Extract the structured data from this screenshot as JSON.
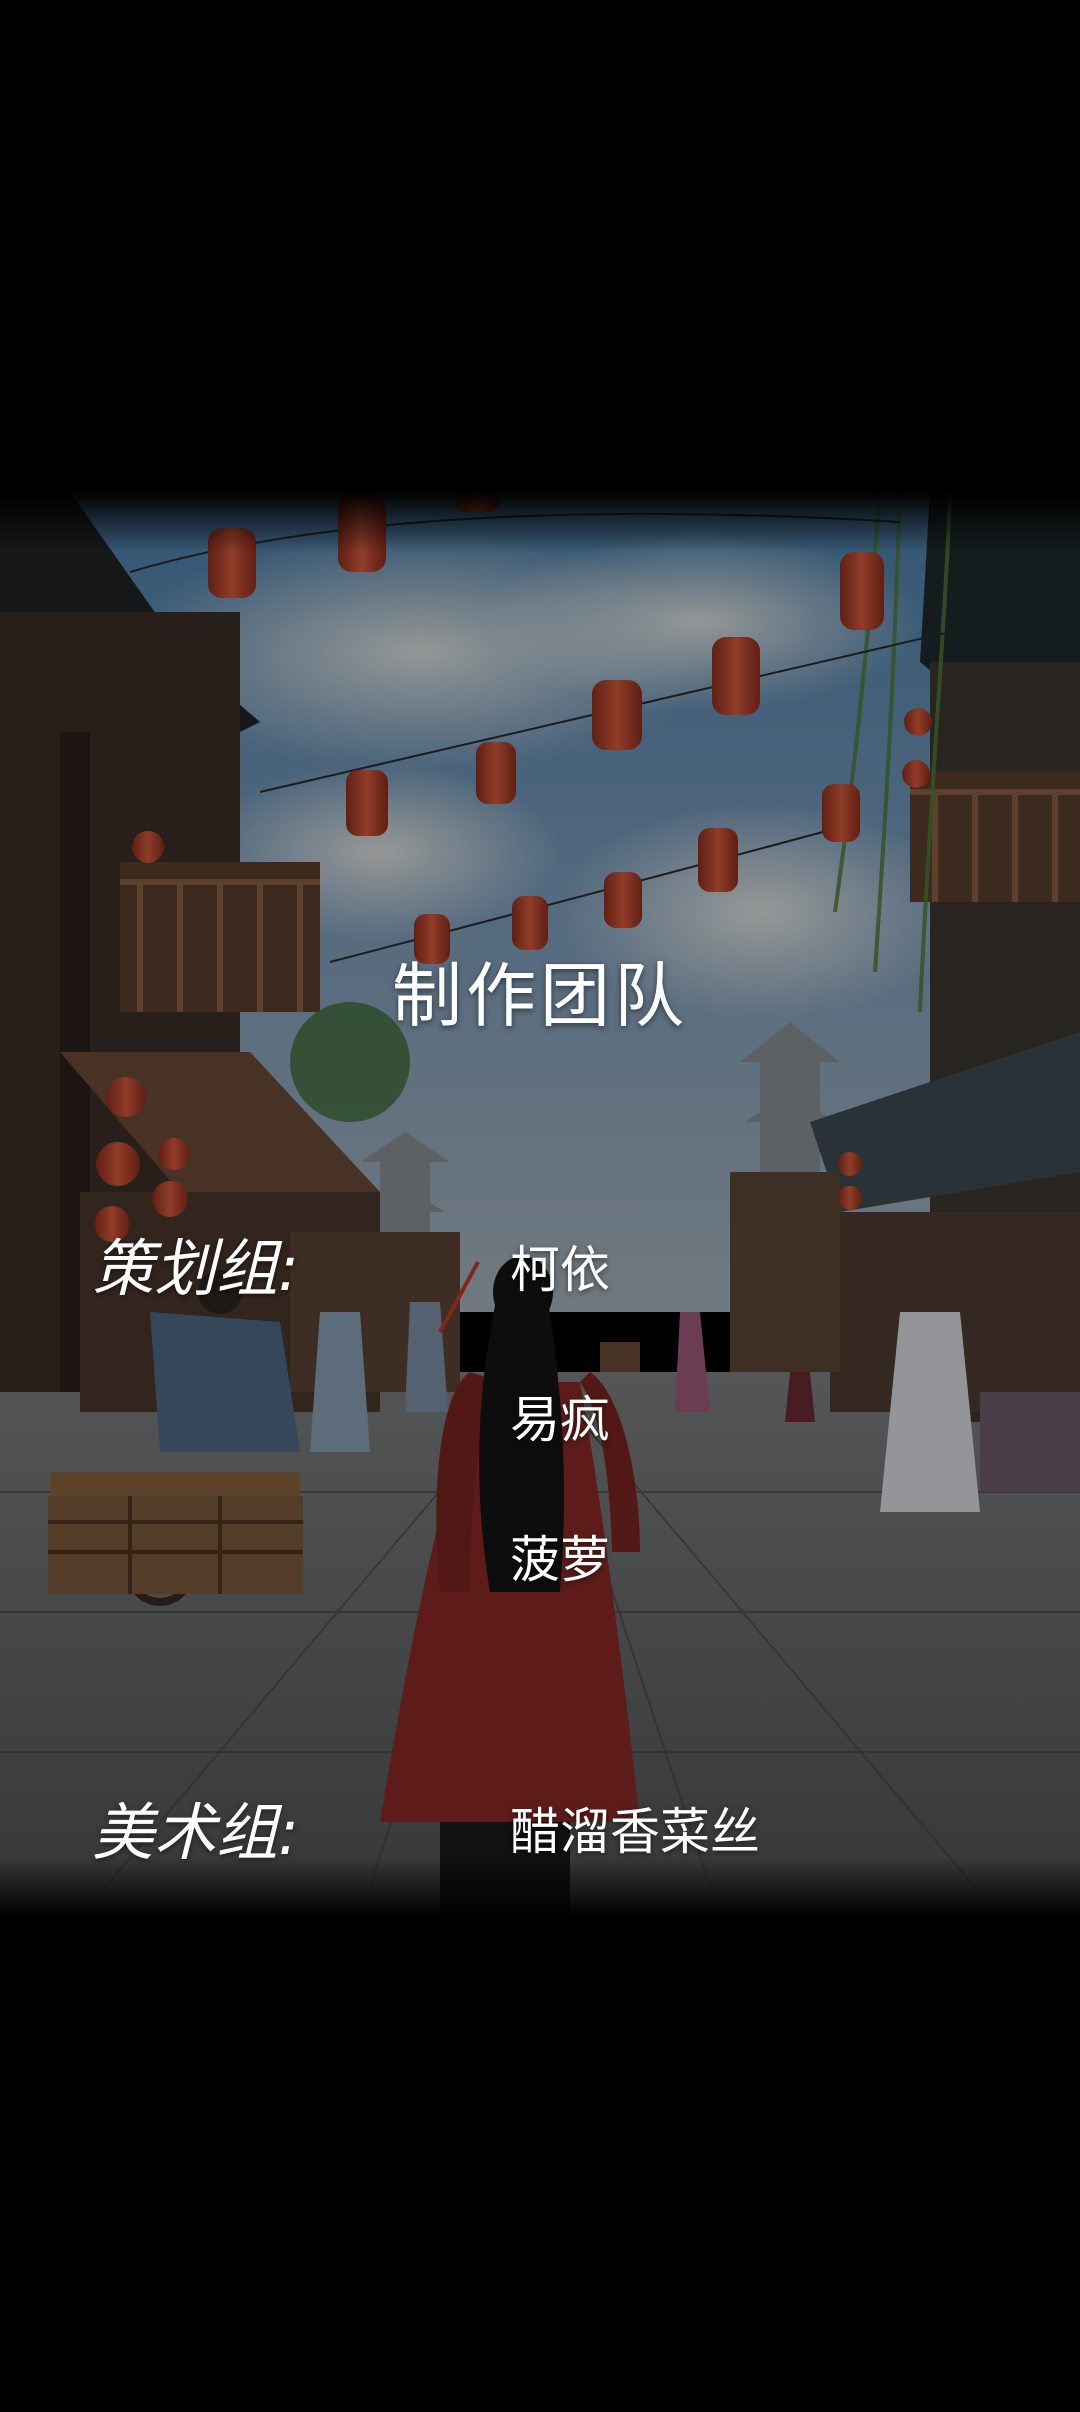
{
  "credits": {
    "title": "制作团队",
    "groups": [
      {
        "label": "策划组:",
        "members": [
          "柯依",
          "易疯",
          "菠萝"
        ]
      },
      {
        "label": "美术组:",
        "members": [
          "醋溜香菜丝"
        ]
      }
    ]
  },
  "colors": {
    "background": "#000000",
    "text": "#ffffff",
    "lantern": "#b2422c"
  }
}
